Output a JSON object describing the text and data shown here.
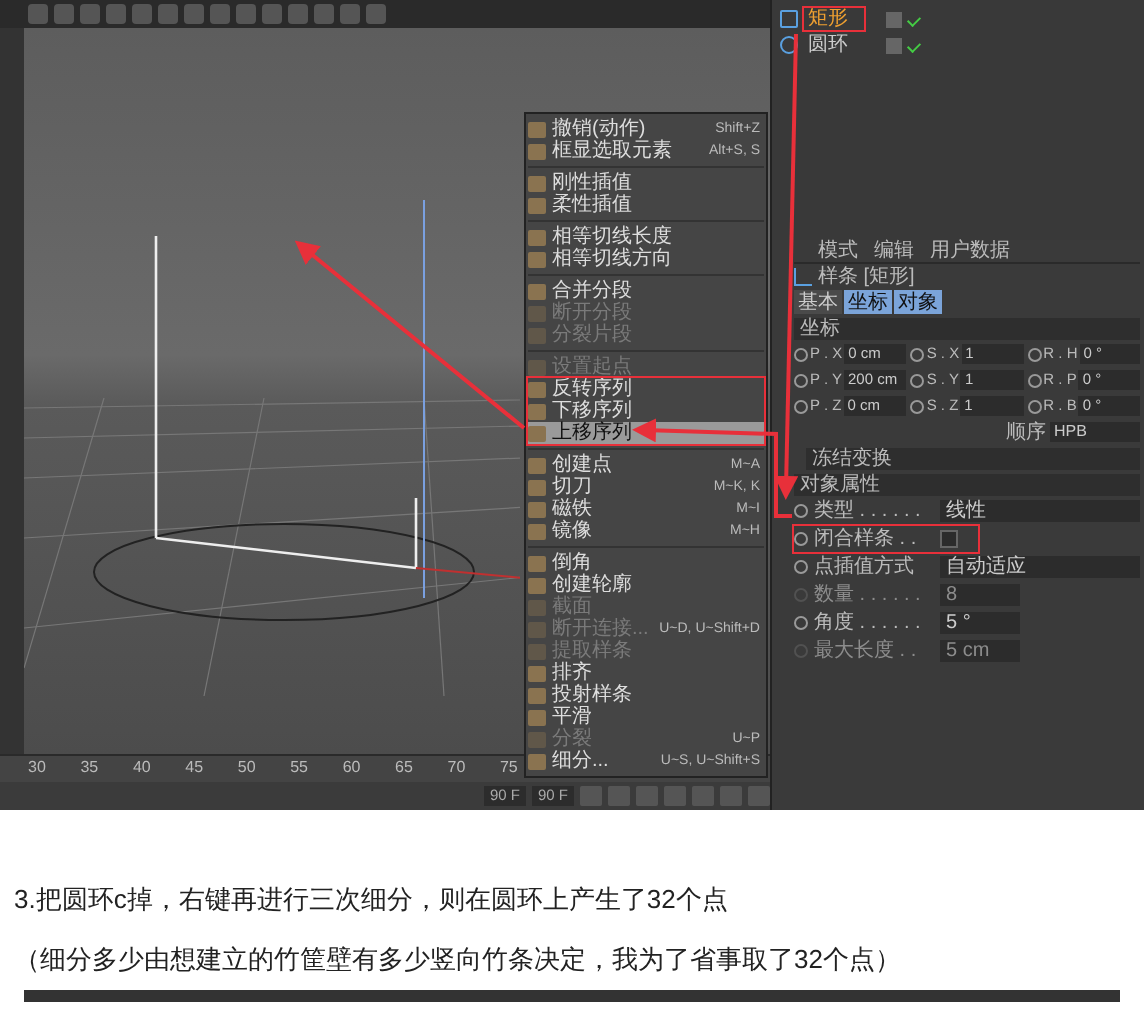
{
  "object_manager": {
    "objects": [
      {
        "name": "矩形",
        "selected": true,
        "boxed": true
      },
      {
        "name": "圆环",
        "selected": false,
        "boxed": false
      }
    ]
  },
  "context_menu": {
    "groups": [
      [
        {
          "label": "撤销(动作)",
          "shortcut": "Shift+Z",
          "disabled": false,
          "selected": false,
          "boxed": false
        },
        {
          "label": "框显选取元素",
          "shortcut": "Alt+S, S",
          "disabled": false,
          "selected": false,
          "boxed": false
        }
      ],
      [
        {
          "label": "刚性插值",
          "disabled": false,
          "selected": false,
          "boxed": false
        },
        {
          "label": "柔性插值",
          "disabled": false,
          "selected": false,
          "boxed": false
        }
      ],
      [
        {
          "label": "相等切线长度",
          "disabled": false,
          "selected": false,
          "boxed": false
        },
        {
          "label": "相等切线方向",
          "disabled": false,
          "selected": false,
          "boxed": false
        }
      ],
      [
        {
          "label": "合并分段",
          "disabled": false,
          "selected": false,
          "boxed": false
        },
        {
          "label": "断开分段",
          "disabled": true,
          "selected": false,
          "boxed": false
        },
        {
          "label": "分裂片段",
          "disabled": true,
          "selected": false,
          "boxed": false
        }
      ],
      [
        {
          "label": "设置起点",
          "disabled": true,
          "selected": false,
          "boxed": false
        },
        {
          "label": "反转序列",
          "disabled": false,
          "selected": false,
          "boxed": true
        },
        {
          "label": "下移序列",
          "disabled": false,
          "selected": false,
          "boxed": true
        },
        {
          "label": "上移序列",
          "disabled": false,
          "selected": true,
          "boxed": true
        }
      ],
      [
        {
          "label": "创建点",
          "shortcut": "M~A",
          "disabled": false,
          "selected": false,
          "boxed": false
        },
        {
          "label": "切刀",
          "shortcut": "M~K, K",
          "disabled": false,
          "selected": false,
          "boxed": false
        },
        {
          "label": "磁铁",
          "shortcut": "M~I",
          "disabled": false,
          "selected": false,
          "boxed": false
        },
        {
          "label": "镜像",
          "shortcut": "M~H",
          "disabled": false,
          "selected": false,
          "boxed": false
        }
      ],
      [
        {
          "label": "倒角",
          "disabled": false,
          "selected": false,
          "boxed": false
        },
        {
          "label": "创建轮廓",
          "disabled": false,
          "selected": false,
          "boxed": false
        },
        {
          "label": "截面",
          "disabled": true,
          "selected": false,
          "boxed": false
        },
        {
          "label": "断开连接...",
          "shortcut": "U~D, U~Shift+D",
          "disabled": true,
          "selected": false,
          "boxed": false
        },
        {
          "label": "提取样条",
          "disabled": true,
          "selected": false,
          "boxed": false
        },
        {
          "label": "排齐",
          "disabled": false,
          "selected": false,
          "boxed": false
        },
        {
          "label": "投射样条",
          "disabled": false,
          "selected": false,
          "boxed": false
        },
        {
          "label": "平滑",
          "disabled": false,
          "selected": false,
          "boxed": false
        },
        {
          "label": "分裂",
          "shortcut": "U~P",
          "disabled": true,
          "selected": false,
          "boxed": false
        },
        {
          "label": "细分...",
          "shortcut": "U~S, U~Shift+S",
          "disabled": false,
          "selected": false,
          "boxed": false
        }
      ]
    ]
  },
  "attributes": {
    "menu": [
      "模式",
      "编辑",
      "用户数据"
    ],
    "object_title": "样条 [矩形]",
    "tabs": [
      {
        "label": "基本",
        "selected": false
      },
      {
        "label": "坐标",
        "selected": true
      },
      {
        "label": "对象",
        "selected": true
      }
    ],
    "coord_section": "坐标",
    "coords": [
      [
        {
          "label": "P . X",
          "value": "0 cm"
        },
        {
          "label": "S . X",
          "value": "1"
        },
        {
          "label": "R . H",
          "value": "0 °"
        }
      ],
      [
        {
          "label": "P . Y",
          "value": "200 cm"
        },
        {
          "label": "S . Y",
          "value": "1"
        },
        {
          "label": "R . P",
          "value": "0 °"
        }
      ],
      [
        {
          "label": "P . Z",
          "value": "0 cm"
        },
        {
          "label": "S . Z",
          "value": "1"
        },
        {
          "label": "R . B",
          "value": "0 °"
        }
      ]
    ],
    "order_label": "顺序",
    "order_value": "HPB",
    "freeze_label": "冻结变换",
    "object_section": "对象属性",
    "properties": [
      {
        "kind": "dropdown",
        "label": "类型 . . . . . .",
        "value": "线性",
        "disabled": false,
        "boxed": false
      },
      {
        "kind": "checkbox",
        "label": "闭合样条 . .",
        "checked": false,
        "disabled": false,
        "boxed": true
      },
      {
        "kind": "dropdown",
        "label": "点插值方式",
        "value": "自动适应",
        "disabled": false,
        "boxed": false
      },
      {
        "kind": "number",
        "label": "数量 . . . . . .",
        "value": "8",
        "disabled": true,
        "boxed": false
      },
      {
        "kind": "number",
        "label": "角度 . . . . . .",
        "value": "5 °",
        "disabled": false,
        "boxed": false
      },
      {
        "kind": "number",
        "label": "最大长度 . .",
        "value": "5 cm",
        "disabled": true,
        "boxed": false
      }
    ]
  },
  "timeline": {
    "ticks": [
      "30",
      "35",
      "40",
      "45",
      "50",
      "55",
      "60",
      "65",
      "70",
      "75"
    ],
    "end_field": "90 F",
    "frame_field": "90 F"
  },
  "caption": [
    "3.把圆环c掉，右键再进行三次细分，则在圆环上产生了32个点",
    "（细分多少由想建立的竹筐壁有多少竖向竹条决定，我为了省事取了32个点）"
  ]
}
